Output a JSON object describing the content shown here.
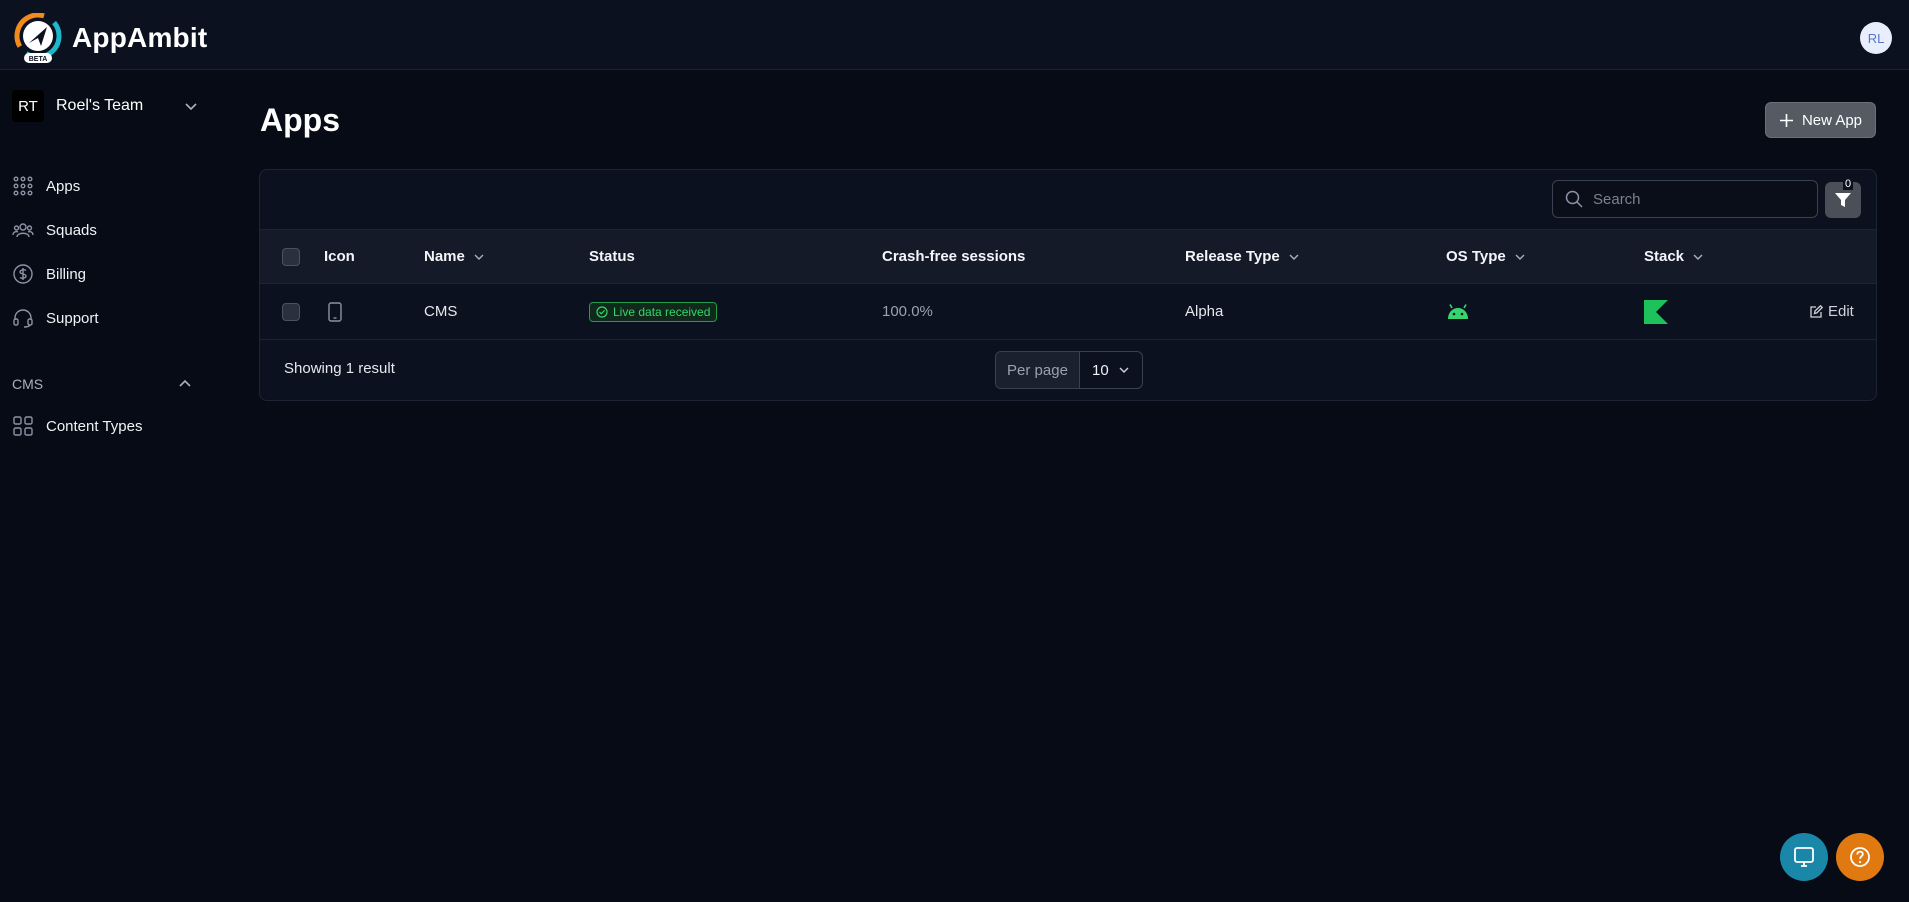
{
  "app": {
    "name": "AppAmbit",
    "beta_label": "BETA",
    "user_initials": "RL"
  },
  "team": {
    "initials": "RT",
    "name": "Roel's Team"
  },
  "sidebar": {
    "items": [
      {
        "label": "Apps",
        "icon": "grid-dots-icon"
      },
      {
        "label": "Squads",
        "icon": "users-icon"
      },
      {
        "label": "Billing",
        "icon": "dollar-circle-icon"
      },
      {
        "label": "Support",
        "icon": "headset-icon"
      }
    ],
    "section": {
      "title": "CMS",
      "items": [
        {
          "label": "Content Types",
          "icon": "squares-icon"
        }
      ]
    }
  },
  "main": {
    "title": "Apps",
    "new_app_label": "New App",
    "search_placeholder": "Search",
    "filter_count": "0",
    "columns": {
      "icon": "Icon",
      "name": "Name",
      "status": "Status",
      "crash": "Crash-free sessions",
      "release": "Release Type",
      "os": "OS Type",
      "stack": "Stack"
    },
    "rows": [
      {
        "name": "CMS",
        "status": "Live data received",
        "crash_free": "100.0%",
        "release_type": "Alpha",
        "os_icon": "android-icon",
        "stack_icon": "kotlin-icon",
        "edit_label": "Edit"
      }
    ],
    "showing": "Showing 1 result",
    "per_page_label": "Per page",
    "per_page_value": "10"
  },
  "colors": {
    "accent_green": "#36d46e",
    "help_orange": "#e07a10",
    "chat_teal": "#1a87a8"
  }
}
